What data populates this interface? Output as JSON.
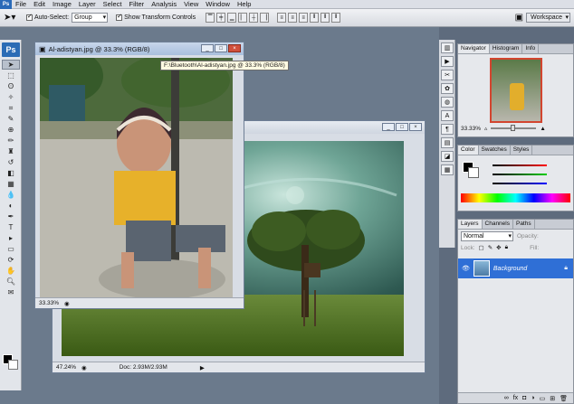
{
  "menu": [
    "File",
    "Edit",
    "Image",
    "Layer",
    "Select",
    "Filter",
    "Analysis",
    "View",
    "Window",
    "Help"
  ],
  "options": {
    "auto_select_label": "Auto-Select:",
    "auto_select_value": "Group",
    "show_transform_label": "Show Transform Controls"
  },
  "workspace": {
    "label": "Workspace"
  },
  "doc_front": {
    "title": "Al-adistyan.jpg @ 33.3% (RGB/8)",
    "zoom": "33.33%",
    "tooltip": "F:\\Bluetooth\\Al-adistyan.jpg @ 33.3% (RGB/8)"
  },
  "doc_back": {
    "zoom": "47.24%",
    "doc_info": "Doc: 2.93M/2.93M"
  },
  "navigator": {
    "tabs": [
      "Navigator",
      "Histogram",
      "Info"
    ],
    "zoom": "33.33%"
  },
  "color": {
    "tabs": [
      "Color",
      "Swatches",
      "Styles"
    ]
  },
  "layers": {
    "tabs": [
      "Layers",
      "Channels",
      "Paths"
    ],
    "blend_mode": "Normal",
    "opacity_label": "Opacity:",
    "lock_label": "Lock:",
    "fill_label": "Fill:",
    "layer_name": "Background"
  },
  "colors": {
    "accent": "#2f6fd6",
    "ps_blue": "#2b6cb5"
  }
}
